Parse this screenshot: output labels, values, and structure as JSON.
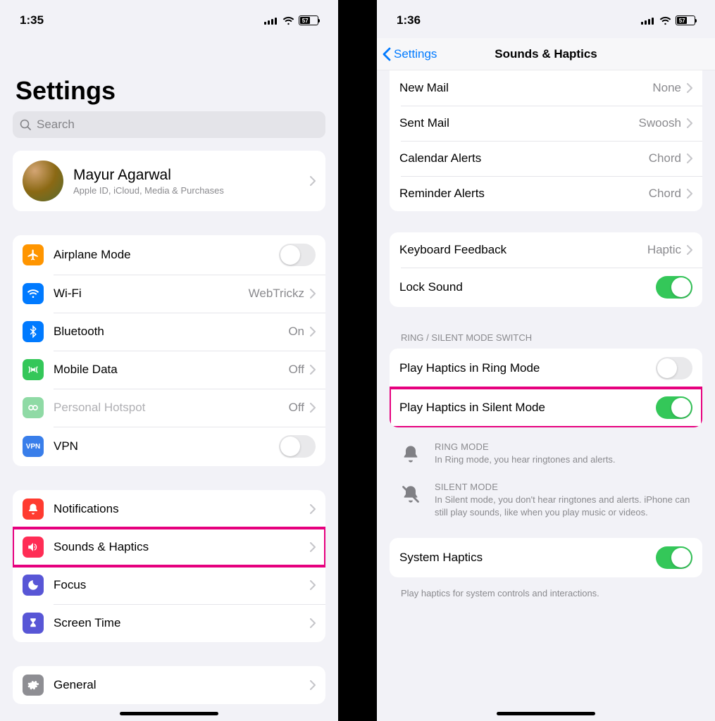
{
  "left": {
    "status": {
      "time": "1:35",
      "battery": "57"
    },
    "title": "Settings",
    "search_placeholder": "Search",
    "profile": {
      "name": "Mayur Agarwal",
      "sub": "Apple ID, iCloud, Media & Purchases"
    },
    "g1": {
      "airplane": "Airplane Mode",
      "wifi": "Wi-Fi",
      "wifi_v": "WebTrickz",
      "bt": "Bluetooth",
      "bt_v": "On",
      "mobile": "Mobile Data",
      "mobile_v": "Off",
      "hotspot": "Personal Hotspot",
      "hotspot_v": "Off",
      "vpn": "VPN"
    },
    "g2": {
      "notif": "Notifications",
      "sounds": "Sounds & Haptics",
      "focus": "Focus",
      "screentime": "Screen Time"
    },
    "g3": {
      "general": "General"
    }
  },
  "right": {
    "status": {
      "time": "1:36",
      "battery": "57"
    },
    "back": "Settings",
    "title": "Sounds & Haptics",
    "g1": {
      "newmail": "New Mail",
      "newmail_v": "None",
      "sentmail": "Sent Mail",
      "sentmail_v": "Swoosh",
      "cal": "Calendar Alerts",
      "cal_v": "Chord",
      "rem": "Reminder Alerts",
      "rem_v": "Chord"
    },
    "g2": {
      "kb": "Keyboard Feedback",
      "kb_v": "Haptic",
      "lock": "Lock Sound"
    },
    "section_ring": "RING / SILENT MODE SWITCH",
    "g3": {
      "ring": "Play Haptics in Ring Mode",
      "silent": "Play Haptics in Silent Mode"
    },
    "info": {
      "ring_t": "RING MODE",
      "ring_d": "In Ring mode, you hear ringtones and alerts.",
      "silent_t": "SILENT MODE",
      "silent_d": "In Silent mode, you don't hear ringtones and alerts. iPhone can still play sounds, like when you play music or videos."
    },
    "g4": {
      "sys": "System Haptics"
    },
    "footer": "Play haptics for system controls and interactions."
  },
  "colors": {
    "orange": "#ff9500",
    "blue": "#007aff",
    "green": "#34c759",
    "green2": "#65c466",
    "grey": "#8e8e93",
    "red": "#ff3b30",
    "pink": "#ff2d55",
    "indigo": "#5856d6",
    "gear": "#8e8e93",
    "vpn": "#397eea",
    "hotspot": "#8fdaa5"
  }
}
